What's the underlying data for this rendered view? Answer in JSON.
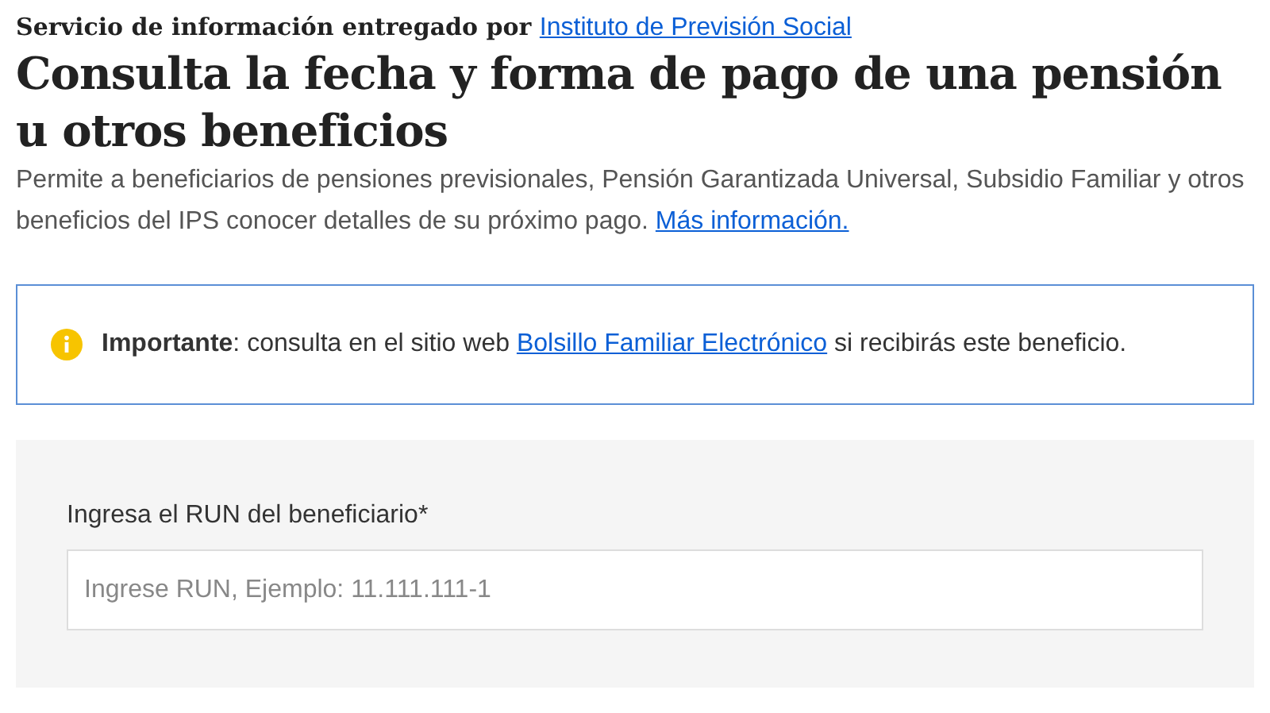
{
  "header": {
    "provider_text": "Servicio de información entregado por",
    "provider_link": "Instituto de Previsión Social"
  },
  "title": "Consulta la fecha y forma de pago de una pensión u otros beneficios",
  "description": {
    "text": "Permite a beneficiarios de pensiones previsionales, Pensión Garantizada Universal, Subsidio Familiar y otros beneficios del IPS conocer detalles de su próximo pago.",
    "link": "Más información."
  },
  "notice": {
    "before": "**Importante**: consulta en el sitio web",
    "link": "Bolsillo Familiar Electrónico",
    "after": "si recibirás este beneficio."
  },
  "form": {
    "label": "Ingresa el RUN del beneficiario*",
    "placeholder": "Ingrese RUN, Ejemplo: 11.111.111-1"
  }
}
